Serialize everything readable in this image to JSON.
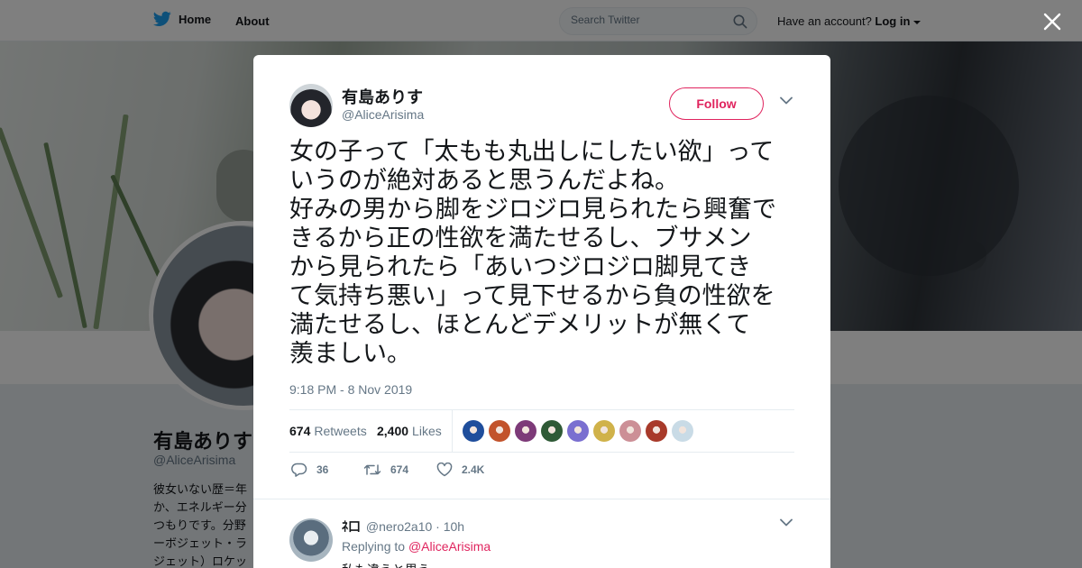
{
  "nav": {
    "home_label": "Home",
    "about_label": "About",
    "search_placeholder": "Search Twitter",
    "account_prompt": "Have an account?",
    "login_label": "Log in"
  },
  "profile": {
    "name": "有島ありす",
    "handle": "@AliceArisima",
    "bio": "彼女いない歴＝年\nか、エネルギー分\nつもりです。分野\nーボジェット・ラ\nジェット）ロケッ"
  },
  "tweet": {
    "author_name": "有島ありす",
    "author_handle": "@AliceArisima",
    "follow_label": "Follow",
    "text": "女の子って「太もも丸出しにしたい欲」って\nいうのが絶対あると思うんだよね。\n好みの男から脚をジロジロ見られたら興奮で\nきるから正の性欲を満たせるし、ブサメン\nから見られたら「あいつジロジロ脚見てき\nて気持ち悪い」って見下せるから負の性欲を\n満たせるし、ほとんどデメリットが無くて\n羨ましい。",
    "timestamp": "9:18 PM - 8 Nov 2019",
    "retweets_count": "674",
    "retweets_label": "Retweets",
    "likes_count": "2,400",
    "likes_label": "Likes",
    "liker_colors": [
      "#1f4e9c",
      "#c2532b",
      "#7d3a78",
      "#2f5a36",
      "#7a6fd0",
      "#d0b24a",
      "#cc8f96",
      "#a83a2a",
      "#c9dbe6"
    ],
    "actions": {
      "reply_count": "36",
      "retweet_count": "674",
      "like_count": "2.4K"
    }
  },
  "reply": {
    "name": "ﾈ口",
    "handle": "@nero2a10",
    "time": "· 10h",
    "replying_prefix": "Replying to",
    "replying_to": "@AliceArisima",
    "text": "私も違うと思う"
  },
  "colors": {
    "accent": "#e0245e",
    "twitter_blue": "#1da1f2",
    "muted": "#657786",
    "text": "#14171a"
  }
}
